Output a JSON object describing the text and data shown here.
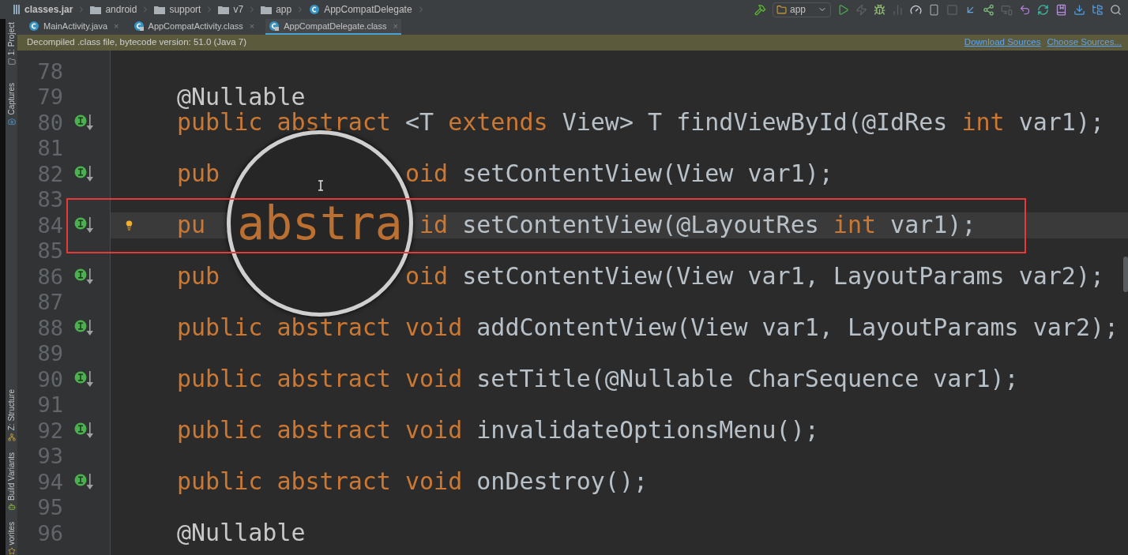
{
  "breadcrumbs": [
    {
      "label": "classes.jar",
      "kind": "jar"
    },
    {
      "label": "android",
      "kind": "folder"
    },
    {
      "label": "support",
      "kind": "folder"
    },
    {
      "label": "v7",
      "kind": "folder"
    },
    {
      "label": "app",
      "kind": "folder"
    },
    {
      "label": "AppCompatDelegate",
      "kind": "class"
    }
  ],
  "run_config": {
    "label": "app"
  },
  "toolbar": [
    {
      "kind": "hammer",
      "disabled": false
    },
    {
      "kind": "run_config"
    },
    {
      "kind": "play",
      "disabled": false
    },
    {
      "kind": "lightning",
      "disabled": true
    },
    {
      "kind": "bug",
      "disabled": false
    },
    {
      "kind": "bars",
      "disabled": true
    },
    {
      "kind": "gauge",
      "disabled": false
    },
    {
      "kind": "phone",
      "disabled": false
    },
    {
      "kind": "stop",
      "disabled": true
    },
    {
      "kind": "arrow",
      "disabled": false
    },
    {
      "kind": "share",
      "disabled": false
    },
    {
      "kind": "monitor",
      "disabled": true
    },
    {
      "kind": "undo",
      "disabled": false
    },
    {
      "kind": "refresh",
      "disabled": false
    },
    {
      "kind": "book",
      "disabled": false
    },
    {
      "kind": "download",
      "disabled": false
    },
    {
      "kind": "tree",
      "disabled": false
    },
    {
      "kind": "search",
      "disabled": false
    }
  ],
  "side_tools_top": [
    {
      "label": "1: Project",
      "kind": "project"
    },
    {
      "label": "Captures",
      "kind": "captures"
    }
  ],
  "side_tools_bottom": [
    {
      "label": "Z: Structure",
      "kind": "structure"
    },
    {
      "label": "Build Variants",
      "kind": "variants"
    },
    {
      "label": "vorites",
      "kind": "favorites"
    }
  ],
  "tabs": [
    {
      "label": "MainActivity.java",
      "kind": "java",
      "selected": false,
      "close": "×"
    },
    {
      "label": "AppCompatActivity.class",
      "kind": "class",
      "selected": false,
      "close": "×"
    },
    {
      "label": "AppCompatDelegate.class",
      "kind": "class",
      "selected": true,
      "close": "×"
    }
  ],
  "banner": {
    "message": "Decompiled .class file, bytecode version: 51.0 (Java 7)",
    "links": [
      "Download Sources",
      "Choose Sources..."
    ]
  },
  "lines": [
    {
      "number": "78",
      "implemented": false,
      "bulb": false,
      "current": false
    },
    {
      "number": "79",
      "implemented": false,
      "bulb": false,
      "current": false,
      "code": [
        {
          "text": "@Nullable",
          "kind": "annotation"
        }
      ]
    },
    {
      "number": "80",
      "implemented": true,
      "bulb": false,
      "current": false,
      "code": [
        {
          "text": "public abstract ",
          "kind": "keyword"
        },
        {
          "text": "<T ",
          "kind": "plain"
        },
        {
          "text": "extends ",
          "kind": "keyword"
        },
        {
          "text": "View> T findViewById(@IdRes ",
          "kind": "plain"
        },
        {
          "text": "int ",
          "kind": "keyword"
        },
        {
          "text": "var1);",
          "kind": "plain"
        }
      ]
    },
    {
      "number": "81",
      "implemented": false,
      "bulb": false,
      "current": false
    },
    {
      "number": "82",
      "implemented": true,
      "bulb": false,
      "current": false,
      "code": [
        {
          "text": "pub",
          "kind": "keyword"
        }
      ],
      "code_after_lens": [
        {
          "text": "oid ",
          "kind": "keyword"
        },
        {
          "text": "setContentView(View var1);",
          "kind": "plain"
        }
      ]
    },
    {
      "number": "83",
      "implemented": false,
      "bulb": false,
      "current": false
    },
    {
      "number": "84",
      "implemented": true,
      "bulb": true,
      "current": true,
      "code": [
        {
          "text": "pu",
          "kind": "keyword"
        }
      ],
      "code_after_lens": [
        {
          "text": "id ",
          "kind": "keyword"
        },
        {
          "text": "setContentView(@LayoutRes ",
          "kind": "plain"
        },
        {
          "text": "int ",
          "kind": "keyword"
        },
        {
          "text": "var1);",
          "kind": "plain"
        }
      ]
    },
    {
      "number": "85",
      "implemented": false,
      "bulb": false,
      "current": false
    },
    {
      "number": "86",
      "implemented": true,
      "bulb": false,
      "current": false,
      "code": [
        {
          "text": "pub",
          "kind": "keyword"
        }
      ],
      "code_after_lens": [
        {
          "text": "oid ",
          "kind": "keyword"
        },
        {
          "text": "setContentView(View var1, LayoutParams var2);",
          "kind": "plain"
        }
      ]
    },
    {
      "number": "87",
      "implemented": false,
      "bulb": false,
      "current": false
    },
    {
      "number": "88",
      "implemented": true,
      "bulb": false,
      "current": false,
      "code": [
        {
          "text": "public abstract void ",
          "kind": "keyword"
        },
        {
          "text": "addContentView(View var1, LayoutParams var2);",
          "kind": "plain"
        }
      ]
    },
    {
      "number": "89",
      "implemented": false,
      "bulb": false,
      "current": false
    },
    {
      "number": "90",
      "implemented": true,
      "bulb": false,
      "current": false,
      "code": [
        {
          "text": "public abstract void ",
          "kind": "keyword"
        },
        {
          "text": "setTitle(@Nullable CharSequence var1);",
          "kind": "plain"
        }
      ]
    },
    {
      "number": "91",
      "implemented": false,
      "bulb": false,
      "current": false
    },
    {
      "number": "92",
      "implemented": true,
      "bulb": false,
      "current": false,
      "code": [
        {
          "text": "public abstract void ",
          "kind": "keyword"
        },
        {
          "text": "invalidateOptionsMenu();",
          "kind": "plain"
        }
      ]
    },
    {
      "number": "93",
      "implemented": false,
      "bulb": false,
      "current": false
    },
    {
      "number": "94",
      "implemented": true,
      "bulb": false,
      "current": false,
      "code": [
        {
          "text": "public abstract void ",
          "kind": "keyword"
        },
        {
          "text": "onDestroy();",
          "kind": "plain"
        }
      ]
    },
    {
      "number": "95",
      "implemented": false,
      "bulb": false,
      "current": false
    },
    {
      "number": "96",
      "implemented": false,
      "bulb": false,
      "current": false,
      "code": [
        {
          "text": "@Nullable",
          "kind": "annotation"
        }
      ]
    }
  ],
  "magnifier": {
    "text": "abstra"
  }
}
